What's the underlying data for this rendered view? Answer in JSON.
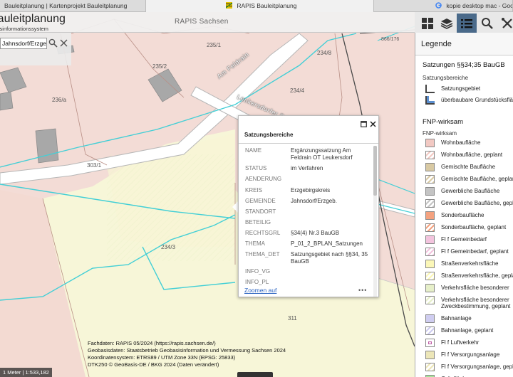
{
  "browser_tabs": [
    {
      "title": "Bauleitplanung | Kartenprojekt Bauleitplanung",
      "active": false
    },
    {
      "title": "RAPIS Bauleitplanung",
      "active": true
    },
    {
      "title": "kopie desktop mac - Goo…",
      "active": false
    }
  ],
  "app": {
    "brand": "Bauleitplanung",
    "brand_sub": "Raumordnungsinformationssystem",
    "center_title": "RAPIS Sachsen"
  },
  "toolbar": [
    "grid-icon",
    "layers-icon",
    "legend-list-icon",
    "search-icon",
    "tools-icon"
  ],
  "search": {
    "value": "Jahnsdorf/Erzgeb"
  },
  "map": {
    "parcel_labels": [
      "235/1",
      "234/8",
      "235/2",
      "234/4",
      "236/a",
      "303/1",
      "234/3",
      "311",
      "866/176"
    ],
    "street_labels": [
      "Am Feldrain",
      "Leukersdorfer S"
    ]
  },
  "popup": {
    "title": "Satzungsbereiche",
    "rows": [
      {
        "key": "NAME",
        "value": "Ergänzungssatzung Am Feldrain OT Leukersdorf"
      },
      {
        "key": "STATUS",
        "value": "im Verfahren"
      },
      {
        "key": "AENDERUNG",
        "value": ""
      },
      {
        "key": "KREIS",
        "value": "Erzgebirgskreis"
      },
      {
        "key": "GEMEINDE",
        "value": "Jahnsdorf/Erzgeb."
      },
      {
        "key": "STANDORT",
        "value": ""
      },
      {
        "key": "BETEILIG",
        "value": ""
      },
      {
        "key": "RECHTSGRL",
        "value": "§34(4) Nr.3 BauGB"
      },
      {
        "key": "THEMA",
        "value": "P_01_2_BPLAN_Satzungen"
      },
      {
        "key": "THEMA_DET",
        "value": "Satzungsgebiet nach §§34, 35 BauGB"
      },
      {
        "key": "INFO_VG",
        "value": ""
      },
      {
        "key": "INFO_PL",
        "value": ""
      }
    ],
    "zoom_link": "Zoomen auf",
    "more": "•••"
  },
  "attribution": [
    "Fachdaten: RAPIS 05/2024 (https://rapis.sachsen.de/)",
    "Geobasisdaten: Staatsbetrieb Geobasisinformation und Vermessung Sachsen 2024",
    "Koordinatensystem: ETRS89 / UTM Zone 33N (EPSG: 25833)",
    "DTK250 © GeoBasis-DE / BKG 2024 (Daten verändert)"
  ],
  "scale": "1 Meter | 1:533,182",
  "legend": {
    "title": "Legende",
    "section1": {
      "heading": "Satzungen §§34;35 BauGB",
      "subheading": "Satzungsbereiche",
      "items": [
        {
          "label": "Satzungsgebiet",
          "color": "#ffffff",
          "style": "bracket"
        },
        {
          "label": "überbaubare Grundstücksfläche",
          "color": "#5b8fd0",
          "style": "bracket-blue"
        }
      ]
    },
    "section2": {
      "heading": "FNP-wirksam",
      "subheading": "FNP-wirksam",
      "items": [
        {
          "label": "Wohnbaufläche",
          "color": "#f2c9c3",
          "style": "fill"
        },
        {
          "label": "Wohnbaufläche, geplant",
          "color": "#f2c9c3",
          "style": "hatch"
        },
        {
          "label": "Gemischte Baufläche",
          "color": "#d8c9a3",
          "style": "fill"
        },
        {
          "label": "Gemischte Baufläche, geplant",
          "color": "#d8c9a3",
          "style": "hatch"
        },
        {
          "label": "Gewerbliche Baufläche",
          "color": "#c4c4c4",
          "style": "fill"
        },
        {
          "label": "Gewerbliche Baufläche, geplant",
          "color": "#c4c4c4",
          "style": "hatch"
        },
        {
          "label": "Sonderbaufläche",
          "color": "#f4a27f",
          "style": "fill"
        },
        {
          "label": "Sonderbaufläche, geplant",
          "color": "#f4a27f",
          "style": "hatch"
        },
        {
          "label": "Fl f Gemeinbedarf",
          "color": "#f3c4de",
          "style": "fill"
        },
        {
          "label": "Fl f Gemeinbedarf, geplant",
          "color": "#f3c4de",
          "style": "hatch"
        },
        {
          "label": "Straßenverkehrsfläche",
          "color": "#fbf7b8",
          "style": "fill"
        },
        {
          "label": "Straßenverkehrsfläche, geplant",
          "color": "#fbf7b8",
          "style": "hatch"
        },
        {
          "label": "Verkehrsfläche besonderer",
          "color": "#e6efc9",
          "style": "fill"
        },
        {
          "label": "Verkehrsfläche besonderer Zweckbestimmung, geplant",
          "color": "#e6efc9",
          "style": "hatch"
        },
        {
          "label": "Bahnanlage",
          "color": "#cfcdf0",
          "style": "fill"
        },
        {
          "label": "Bahnanlage, geplant",
          "color": "#cfcdf0",
          "style": "hatch"
        },
        {
          "label": "Fl f Luftverkehr",
          "color": "#f5e3f0",
          "style": "dot"
        },
        {
          "label": "Fl f Versorgungsanlage",
          "color": "#ece6b8",
          "style": "fill"
        },
        {
          "label": "Fl f Versorgungsanlage, geplant",
          "color": "#ece6b8",
          "style": "hatch"
        },
        {
          "label": "Grünfläche",
          "color": "#a6e39a",
          "style": "fill"
        }
      ]
    }
  }
}
